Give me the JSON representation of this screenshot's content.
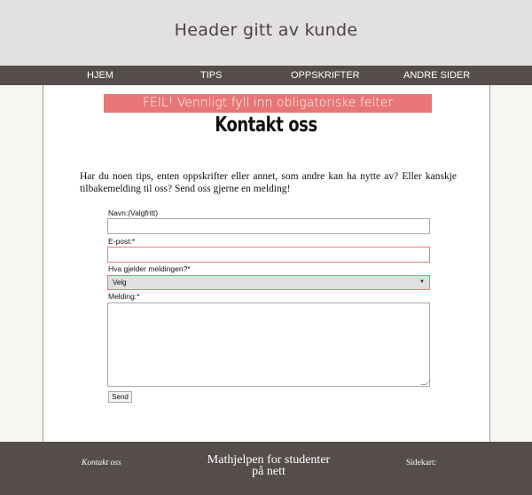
{
  "header": {
    "title": "Header gitt av kunde"
  },
  "nav": {
    "items": [
      "HJEM",
      "TIPS",
      "OPPSKRIFTER",
      "ANDRE SIDER"
    ]
  },
  "error": {
    "message": "FEIL! Vennligt fyll inn obligatoriske felter"
  },
  "page": {
    "title": "Kontakt oss",
    "intro": "Har du noen tips, enten oppskrifter eller annet, som andre kan ha nytte av? Eller kanskje tilbakemelding til oss? Send oss gjerne en melding!"
  },
  "form": {
    "name_label": "Navn:(Valgfritt)",
    "name_value": "",
    "email_label": "E-post:*",
    "email_value": "",
    "subject_label": "Hva gjelder meldingen?*",
    "subject_selected": "Velg",
    "message_label": "Melding:*",
    "message_value": "",
    "send_label": "Send"
  },
  "footer": {
    "contact_link": "Kontakt oss",
    "center_line1": "Mathjelpen for studenter",
    "center_line2": "på nett",
    "sitemap_label": "Sidekart:"
  },
  "colors": {
    "header_bg": "#e3e0e0",
    "nav_bg": "#544d4c",
    "error_bg": "#e87676",
    "invalid_border": "#e87a7a"
  }
}
